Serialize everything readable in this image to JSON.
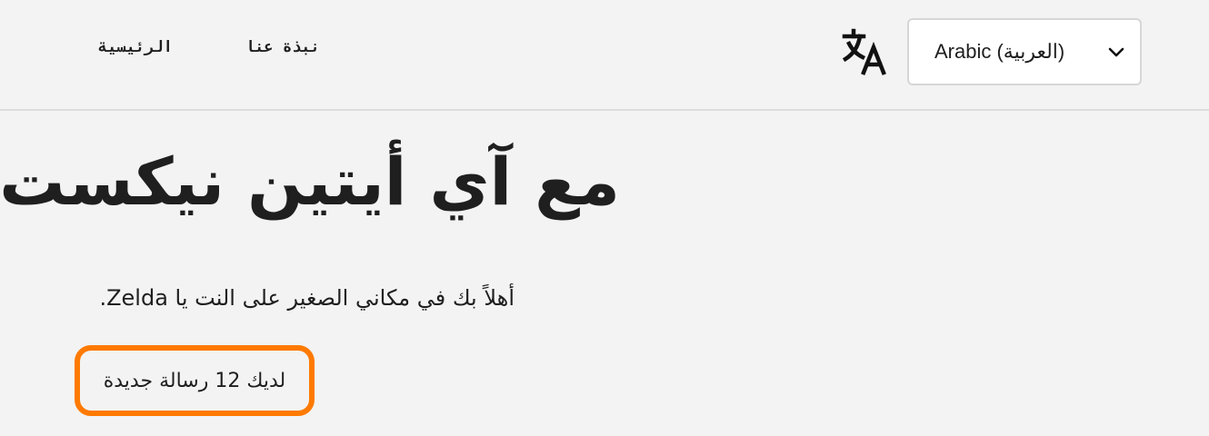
{
  "nav": {
    "home": "الرئيسية",
    "about": "نبذة عنا"
  },
  "language": {
    "icon": "translate-icon",
    "selected": "Arabic (العربية)",
    "chevron_icon": "chevron-down-icon"
  },
  "main": {
    "title": "مع آي أيتين نيكست",
    "welcome": "أهلاً بك في مكاني الصغير على النت يا Zelda.",
    "messages_notice": "لديك 12 رسالة جديدة",
    "highlight_color": "#ff7a00"
  }
}
